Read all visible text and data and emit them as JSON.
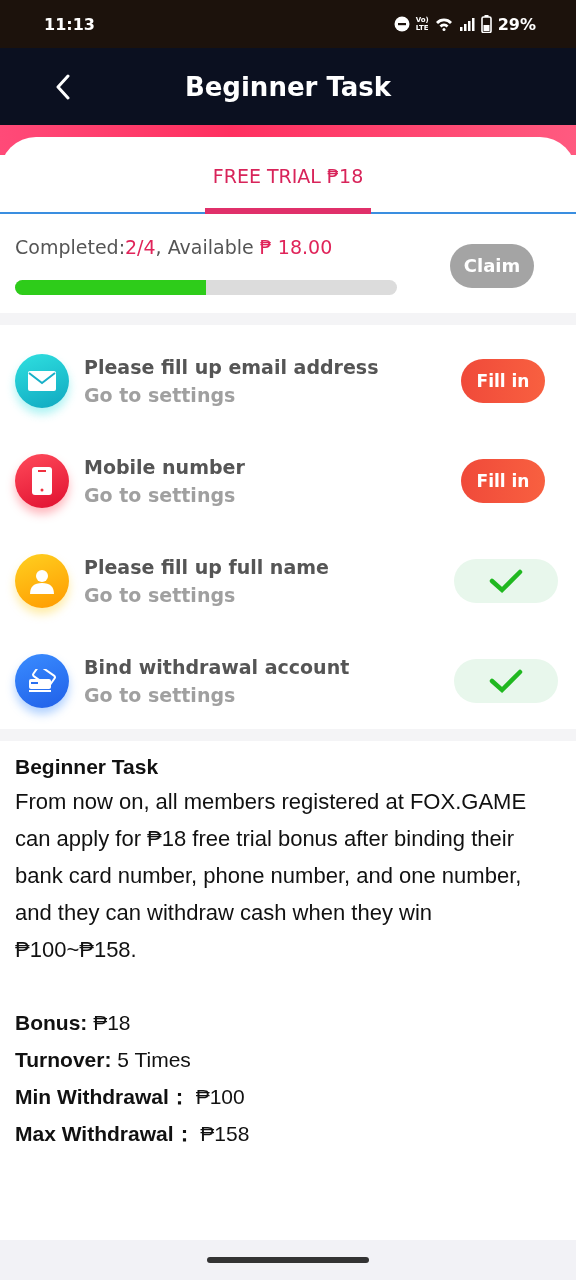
{
  "status_bar": {
    "time": "11:13",
    "volte": [
      "Vo)",
      "LTE"
    ],
    "battery": "29%"
  },
  "header": {
    "title": "Beginner Task"
  },
  "tabs": [
    {
      "label": "FREE TRIAL ₱18",
      "selected": true
    }
  ],
  "progress": {
    "completed_label": "Completed:",
    "completed": "2/4",
    "available_label": ", Available",
    "available": "₱ 18.00",
    "level": 0.5,
    "claim": {
      "label": "Claim",
      "disabled": true
    }
  },
  "tasks": [
    {
      "kind": "email",
      "title": "Please fill up email address",
      "subtitle": "Go to settings",
      "done": false,
      "button": "Fill in"
    },
    {
      "kind": "phone",
      "title": "Mobile number",
      "subtitle": "Go to settings",
      "done": false,
      "button": "Fill in"
    },
    {
      "kind": "person",
      "title": "Please fill up full name",
      "subtitle": "Go to settings",
      "done": true
    },
    {
      "kind": "card",
      "title": "Bind withdrawal account",
      "subtitle": "Go to settings",
      "done": true
    }
  ],
  "description": {
    "title": "Beginner Task",
    "body": "From now on, all members registered at FOX.GAME can apply for ₱18 free trial bonus after binding their bank card number, phone number, and one number, and they can withdraw cash when they win ₱100~₱158.",
    "details": [
      "**Bonus:** ₱18",
      "**Turnover:** 5 Times",
      "**Min Withdrawal：** ₱100",
      "**Max Withdrawal：** ₱158"
    ]
  }
}
